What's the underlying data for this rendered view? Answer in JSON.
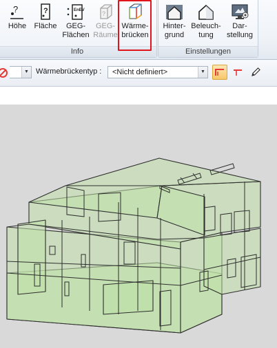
{
  "ribbon": {
    "buttons": [
      {
        "id": "hoehe",
        "label1": "Höhe",
        "label2": ""
      },
      {
        "id": "flaeche",
        "label1": "Fläche",
        "label2": ""
      },
      {
        "id": "geg_flaechen",
        "label1": "GEG-",
        "label2": "Flächen"
      },
      {
        "id": "geg_raeume",
        "label1": "GEG-",
        "label2": "Räume"
      },
      {
        "id": "waermebruecken",
        "label1": "Wärme-",
        "label2": "brücken"
      },
      {
        "id": "hintergrund",
        "label1": "Hinter-",
        "label2": "grund"
      },
      {
        "id": "beleuchtung",
        "label1": "Beleuch-",
        "label2": "tung"
      },
      {
        "id": "darstellung",
        "label1": "Dar-",
        "label2": "stellung"
      }
    ],
    "groups": {
      "info": "Info",
      "einstellungen": "Einstellungen"
    }
  },
  "toolbar": {
    "waermebrueckentyp_label": "Wärmebrückentyp :",
    "waermebrueckentyp_value": "<Nicht definiert>"
  },
  "icons": {
    "hoehe": "height-icon",
    "flaeche": "area-icon",
    "geg_flaechen": "geg-areas-icon",
    "geg_raeume": "geg-rooms-icon",
    "waermebruecken": "thermal-bridge-icon",
    "hintergrund": "background-house-icon",
    "beleuchtung": "lighting-house-icon",
    "darstellung": "display-monitor-icon"
  },
  "colors": {
    "highlight": "#e0141b",
    "model_fill": "#bfe0a8",
    "model_edge": "#2d2d2d",
    "active_tool": "#f8c86a"
  }
}
